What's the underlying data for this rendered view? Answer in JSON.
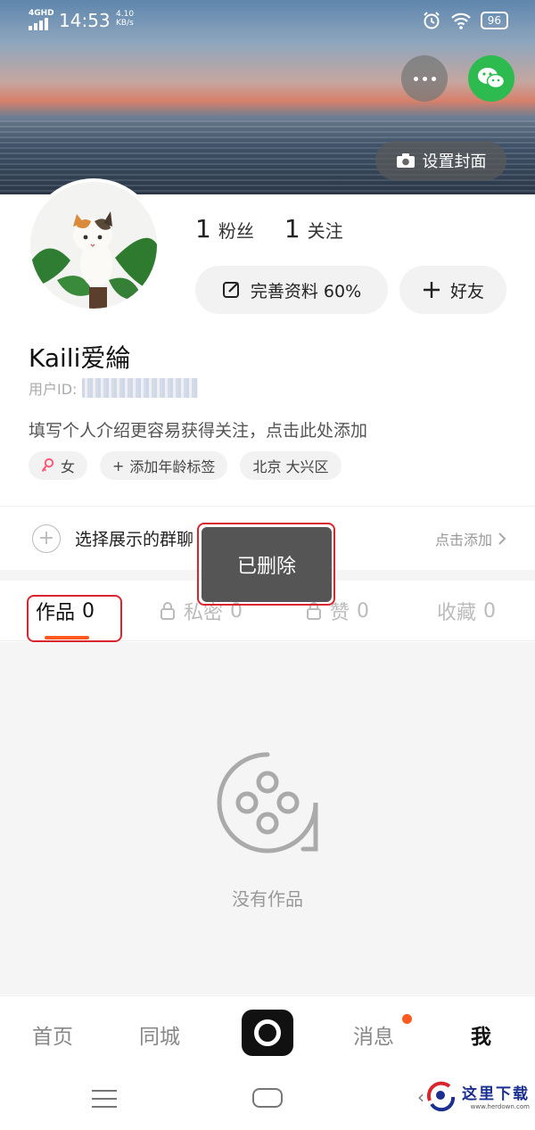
{
  "status": {
    "network": "4GHD",
    "time": "14:53",
    "speed": "4.10",
    "speed_unit": "KB/s",
    "battery": "96"
  },
  "cover": {
    "set_cover_label": "设置封面"
  },
  "profile": {
    "fans_count": "1",
    "fans_label": "粉丝",
    "following_count": "1",
    "following_label": "关注",
    "complete_profile_label": "完善资料 60%",
    "add_friend_label": "好友",
    "nickname": "Kaili爱綸",
    "uid_label": "用户ID:",
    "bio_placeholder": "填写个人介绍更容易获得关注，点击此处添加",
    "tags": [
      "女",
      "添加年龄标签",
      "北京 大兴区"
    ]
  },
  "group_chat": {
    "label": "选择展示的群聊",
    "action": "点击添加"
  },
  "toast": {
    "message": "已删除"
  },
  "tabs": [
    {
      "label": "作品",
      "count": "0"
    },
    {
      "label": "私密",
      "count": "0"
    },
    {
      "label": "赞",
      "count": "0"
    },
    {
      "label": "收藏",
      "count": "0"
    }
  ],
  "empty_state": {
    "message": "没有作品"
  },
  "bottom_nav": {
    "home": "首页",
    "nearby": "同城",
    "messages": "消息",
    "me": "我"
  },
  "watermark": {
    "text": "这里下载",
    "url": "www.herdown.com"
  },
  "colors": {
    "accent": "#ff5a1f",
    "annotation": "#d9262e",
    "wechat": "#2dbb4f"
  }
}
